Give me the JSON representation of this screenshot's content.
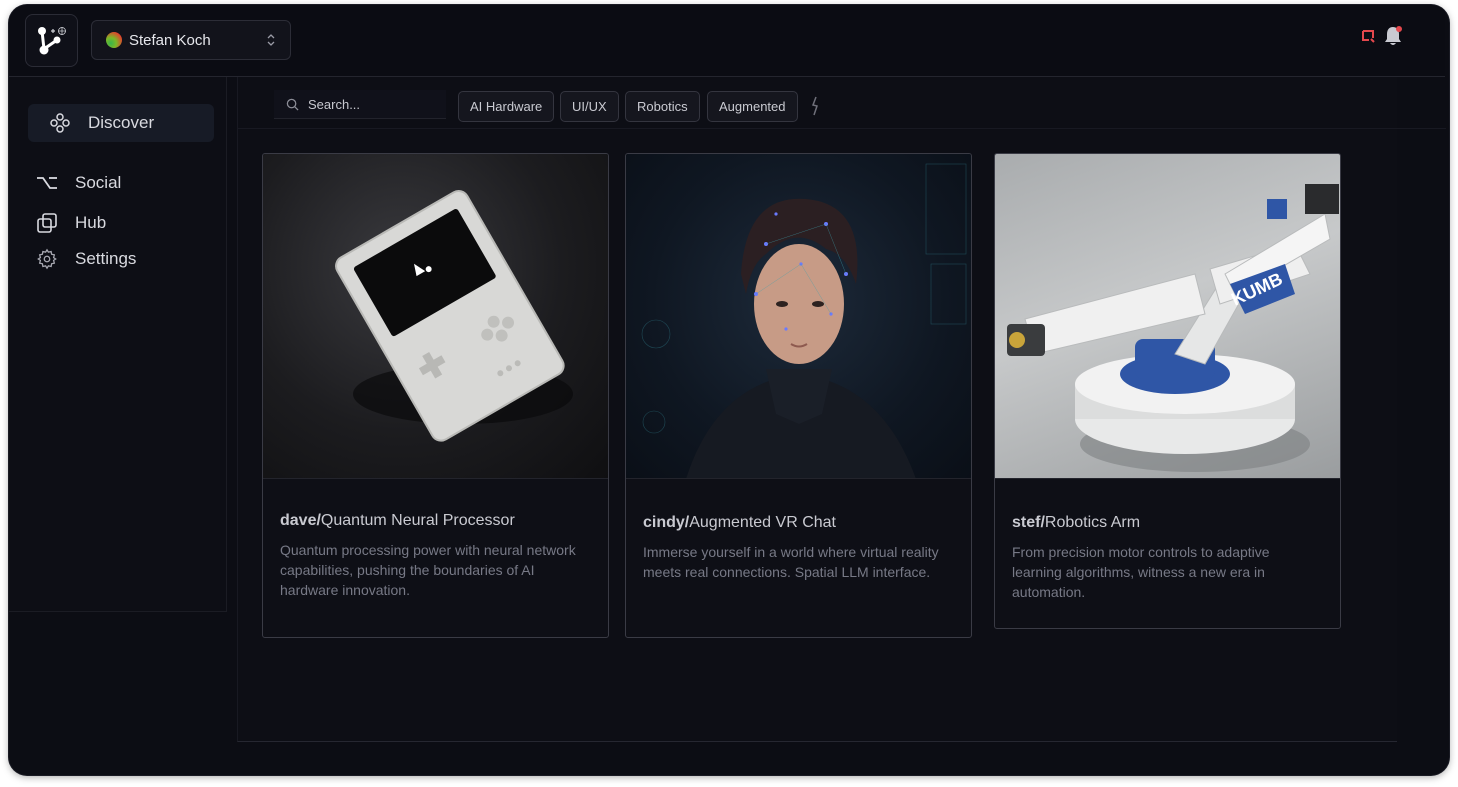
{
  "org": {
    "name": "Stefan Koch"
  },
  "sidebar": {
    "items": [
      {
        "label": "Discover",
        "icon": "discover-icon"
      },
      {
        "label": "Social",
        "icon": "option-key-icon"
      },
      {
        "label": "Hub",
        "icon": "hub-icon"
      },
      {
        "label": "Settings",
        "icon": "gear-icon"
      }
    ]
  },
  "search": {
    "placeholder": "Search..."
  },
  "filters": [
    "AI Hardware",
    "UI/UX",
    "Robotics",
    "Augmented"
  ],
  "cards": [
    {
      "owner": "dave/",
      "name": "Quantum Neural Processor",
      "description": "Quantum processing power with neural network capabilities, pushing the boundaries of AI hardware innovation."
    },
    {
      "owner": "cindy/",
      "name": "Augmented VR Chat",
      "description": "Immerse yourself in a world where virtual reality meets real connections. Spatial LLM interface."
    },
    {
      "owner": "stef/",
      "name": "Robotics Arm",
      "description": "From precision motor controls to adaptive learning algorithms, witness a new era in automation."
    }
  ],
  "colors": {
    "background": "#0c0d14",
    "card_border": "#3a3b45",
    "accent_red": "#e5484d",
    "active_nav": "#171b26"
  }
}
